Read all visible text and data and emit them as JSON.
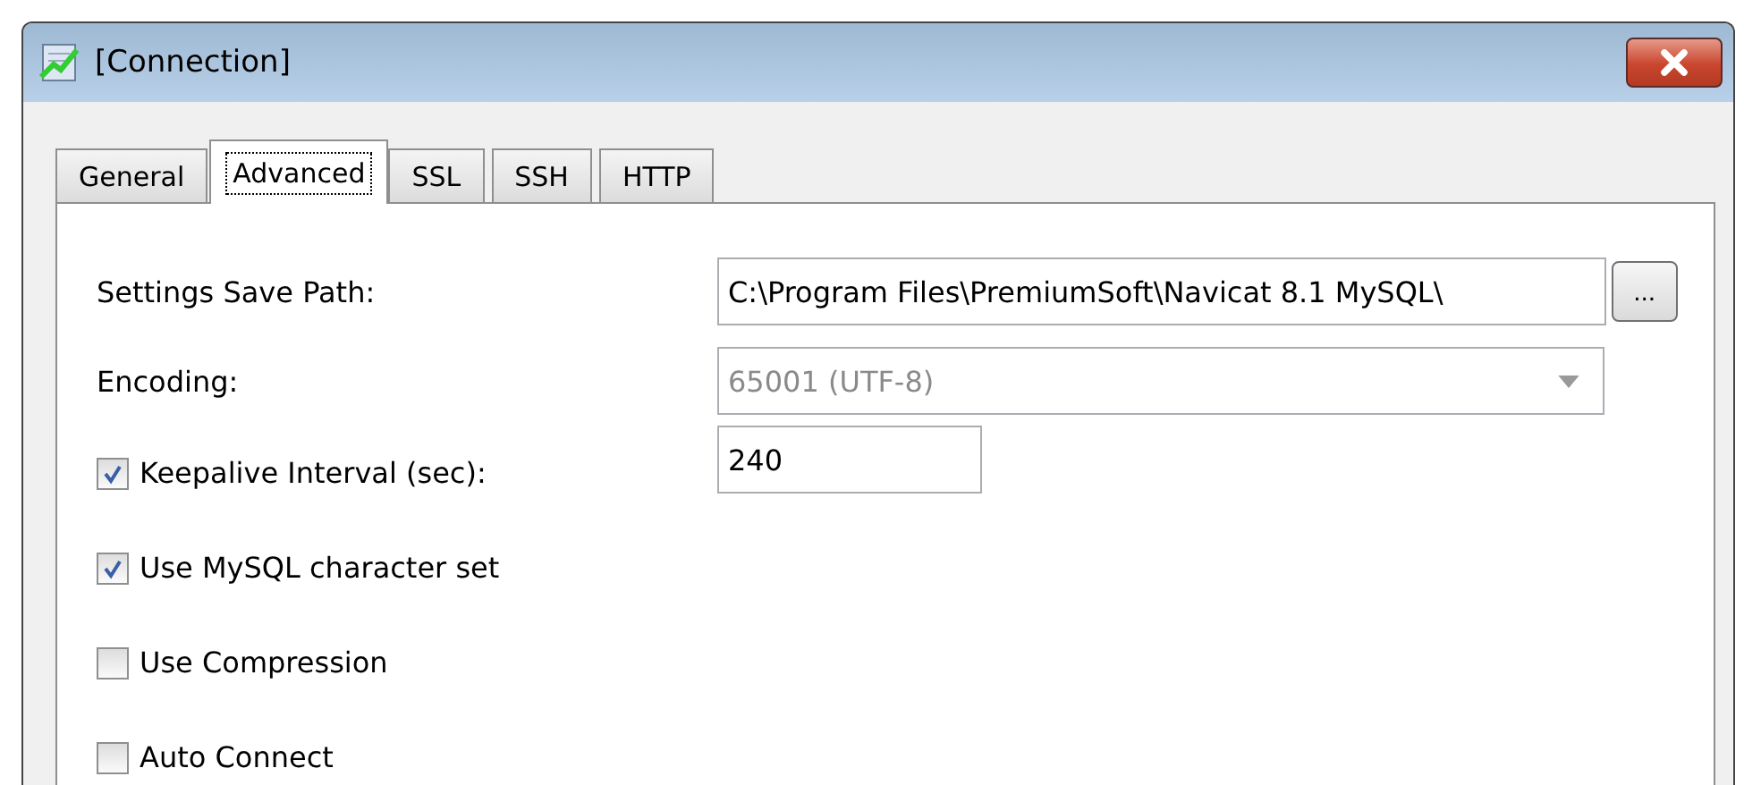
{
  "window": {
    "title": "[Connection]"
  },
  "tabs": [
    {
      "label": "General",
      "selected": false
    },
    {
      "label": "Advanced",
      "selected": true
    },
    {
      "label": "SSL",
      "selected": false
    },
    {
      "label": "SSH",
      "selected": false
    },
    {
      "label": "HTTP",
      "selected": false
    }
  ],
  "rows": [
    {
      "kind": "field",
      "label": "Settings Save Path:",
      "field": {
        "kind": "text",
        "value": "C:\\Program Files\\PremiumSoft\\Navicat 8.1 MySQL\\",
        "disabled": false,
        "button": "..."
      }
    },
    {
      "kind": "field",
      "label": "Encoding:",
      "field": {
        "kind": "select",
        "value": "65001 (UTF-8)",
        "disabled": true
      }
    },
    {
      "kind": "checkbox",
      "label": "Keepalive Interval (sec):",
      "checked": true,
      "field": {
        "kind": "short",
        "value": "240",
        "disabled": false
      }
    },
    {
      "kind": "checkbox",
      "label": "Use MySQL character set",
      "checked": true
    },
    {
      "kind": "checkbox",
      "label": "Use Compression",
      "checked": false
    },
    {
      "kind": "checkbox",
      "label": "Auto Connect",
      "checked": false
    }
  ]
}
